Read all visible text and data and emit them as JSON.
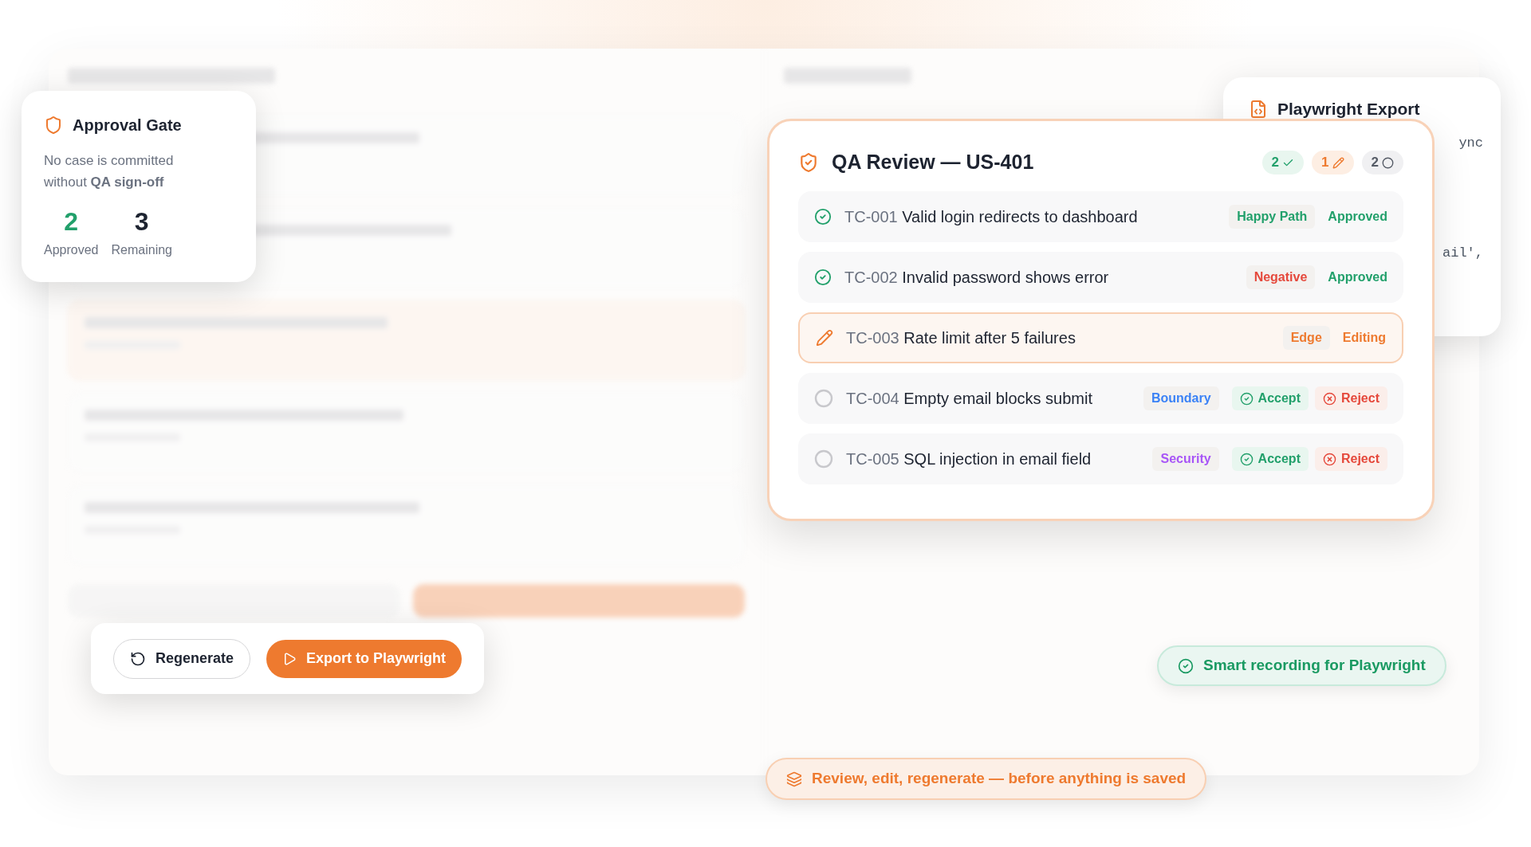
{
  "approval_gate": {
    "title": "Approval Gate",
    "text": "No case is committed without **QA sign-off**",
    "stats": [
      {
        "value": "2",
        "label": "Approved",
        "kind": "approved"
      },
      {
        "value": "3",
        "label": "Remaining",
        "kind": "remaining"
      }
    ]
  },
  "playwright_export": {
    "title": "Playwright Export",
    "code_lines": [
      "ync",
      "ail',"
    ]
  },
  "qa_review": {
    "title": "QA Review — US-401",
    "counts": [
      {
        "value": "2",
        "kind": "approved"
      },
      {
        "value": "1",
        "kind": "editing"
      },
      {
        "value": "2",
        "kind": "pending"
      }
    ],
    "cases": [
      {
        "id": "TC-001",
        "title": "Valid login redirects to dashboard",
        "tag": "Happy Path",
        "color": "#22a06b",
        "kind": "approved",
        "status": "Approved"
      },
      {
        "id": "TC-002",
        "title": "Invalid password shows error",
        "tag": "Negative",
        "color": "#e5483b",
        "kind": "approved",
        "status": "Approved"
      },
      {
        "id": "TC-003",
        "title": "Rate limit after 5 failures",
        "tag": "Edge",
        "color": "#ee7a2f",
        "kind": "editing",
        "status": "Editing"
      },
      {
        "id": "TC-004",
        "title": "Empty email blocks submit",
        "tag": "Boundary",
        "color": "#3b82f6",
        "kind": "pending",
        "actions": [
          "Accept",
          "Reject"
        ]
      },
      {
        "id": "TC-005",
        "title": "SQL injection in email field",
        "tag": "Security",
        "color": "#a855f7",
        "kind": "pending",
        "actions": [
          "Accept",
          "Reject"
        ]
      }
    ]
  },
  "buttons": [
    {
      "label": "Regenerate",
      "kind": "secondary"
    },
    {
      "label": "Export to Playwright",
      "kind": "primary"
    }
  ],
  "pills": [
    {
      "text": "Smart recording for Playwright",
      "kind": "success"
    },
    {
      "text": "Review, edit, regenerate — before anything is saved",
      "kind": "info"
    }
  ]
}
